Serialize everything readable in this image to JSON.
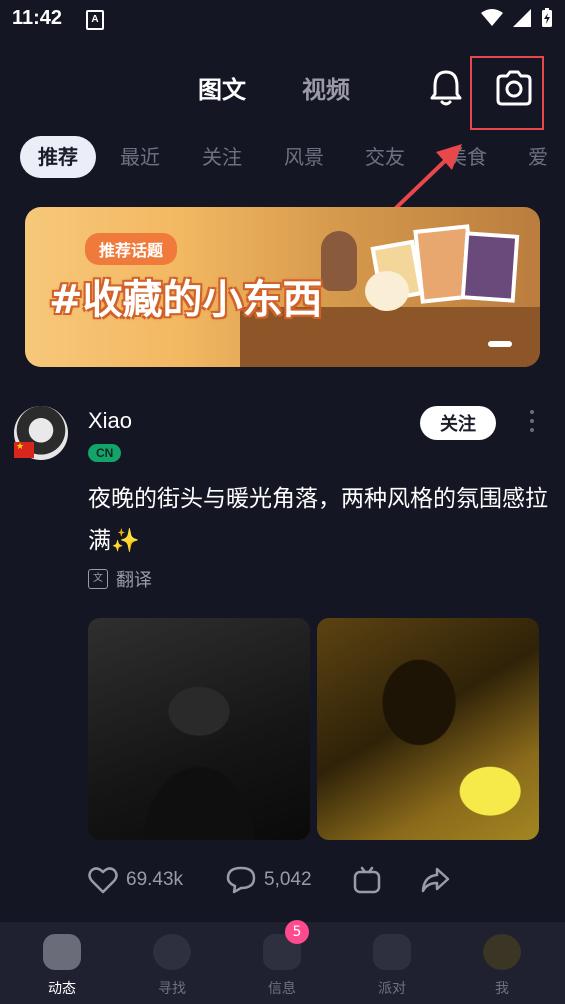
{
  "status_bar": {
    "time": "11:42",
    "app_indicator": "A"
  },
  "top_tabs": {
    "active": "图文",
    "inactive": "视频"
  },
  "icons": {
    "bell": "bell-icon",
    "camera": "camera-icon"
  },
  "categories": [
    "推荐",
    "最近",
    "关注",
    "风景",
    "交友",
    "美食",
    "爱"
  ],
  "banner": {
    "tag": "推荐话题",
    "title": "#收藏的小东西"
  },
  "post": {
    "username": "Xiao",
    "region_badge": "CN",
    "follow_label": "关注",
    "text": "夜晚的街头与暖光角落，两种风格的氛围感拉满✨",
    "translate_label": "翻译",
    "likes": "69.43k",
    "comments": "5,042"
  },
  "bottom_nav": {
    "items": [
      {
        "label": "动态",
        "active": true
      },
      {
        "label": "寻找",
        "active": false
      },
      {
        "label": "信息",
        "active": false,
        "badge": "5"
      },
      {
        "label": "派对",
        "active": false
      },
      {
        "label": "我",
        "active": false
      }
    ]
  },
  "colors": {
    "background": "#151624",
    "highlight_box": "#e8474c",
    "badge_pink": "#ff4b8d",
    "region_green": "#14a36a"
  }
}
